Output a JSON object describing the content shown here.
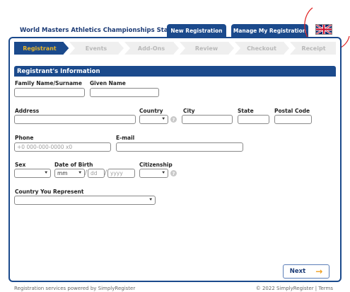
{
  "header": {
    "event_title": "World Masters Athletics Championships Sta...",
    "tab_new_registration": "New Registration",
    "tab_manage_registration": "Manage My Registration"
  },
  "steps": [
    {
      "label": "Registrant",
      "active": true
    },
    {
      "label": "Events",
      "active": false
    },
    {
      "label": "Add-Ons",
      "active": false
    },
    {
      "label": "Review",
      "active": false
    },
    {
      "label": "Checkout",
      "active": false
    },
    {
      "label": "Receipt",
      "active": false
    }
  ],
  "colors": {
    "brand_blue": "#1b4a8c",
    "active_step": "#e8b52a",
    "next_arrow": "#f0a020"
  },
  "form": {
    "section_title": "Registrant's Information",
    "family_name_label": "Family Name/Surname",
    "given_name_label": "Given Name",
    "address_label": "Address",
    "country_label": "Country",
    "city_label": "City",
    "state_label": "State",
    "postal_code_label": "Postal Code",
    "phone_label": "Phone",
    "phone_placeholder": "+0 000-000-0000 x0",
    "email_label": "E-mail",
    "sex_label": "Sex",
    "dob_label": "Date of Birth",
    "dob_month_value": "mm",
    "dob_day_placeholder": "dd",
    "dob_year_placeholder": "yyyy",
    "citizenship_label": "Citizenship",
    "country_represent_label": "Country You Represent",
    "help_glyph": "?",
    "slash_glyph": "/"
  },
  "actions": {
    "next_label": "Next",
    "next_arrow": "→"
  },
  "footer": {
    "left_text": "Registration services powered by SimplyRegister",
    "right_text": "© 2022 SimplyRegister | Terms"
  }
}
